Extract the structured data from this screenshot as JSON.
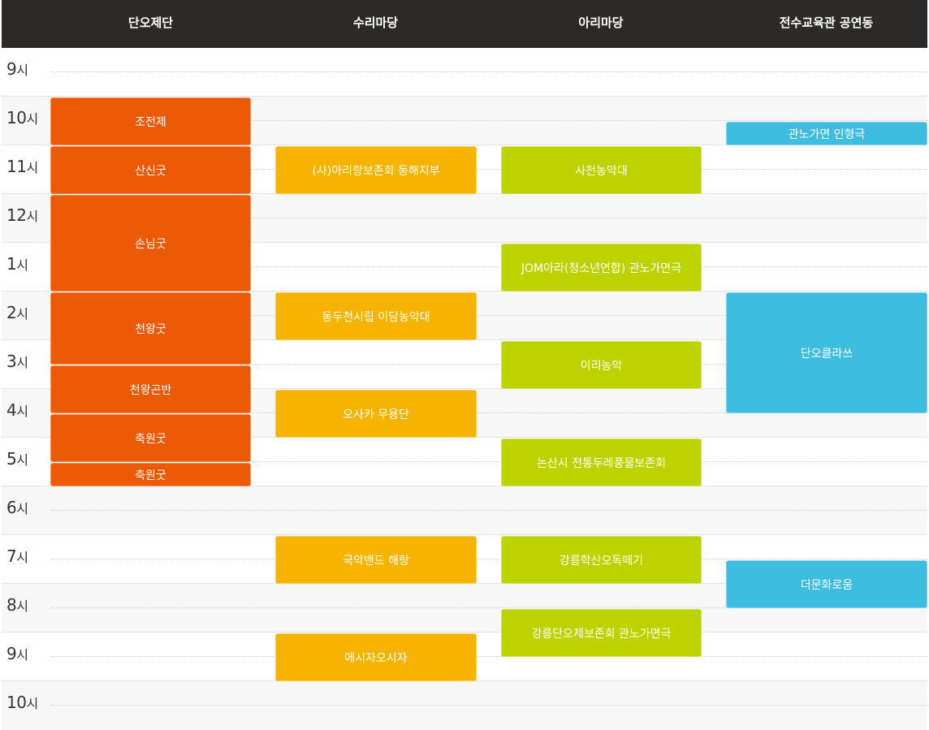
{
  "columns": [
    "단오제단",
    "수리마당",
    "아리마당",
    "전수교육관 공연동"
  ],
  "hours": [
    "9",
    "10",
    "11",
    "12",
    "1",
    "2",
    "3",
    "4",
    "5",
    "6",
    "7",
    "8",
    "9",
    "10"
  ],
  "hour_suffix": "시",
  "events": {
    "dano_1": "조전제",
    "dano_2": "산신굿",
    "dano_3": "손님굿",
    "dano_4": "천왕굿",
    "dano_5": "천왕곤반",
    "dano_6": "축원굿",
    "dano_7": "축원굿",
    "suri_1": "(사)아리랑보존회 동해지부",
    "suri_2": "동두천시립 이담농악대",
    "suri_3": "오사카 무용단",
    "suri_4": "국악밴드 해랑",
    "suri_5": "에시자오시자",
    "ari_1": "사천농악대",
    "ari_2": "JOM아라(청소년연합) 관노가면극",
    "ari_3": "이리농악",
    "ari_4": "논산시 전통두레풍물보존회",
    "ari_5": "강릉학산오독떼기",
    "ari_6": "강릉단오제보존회 관노가면극",
    "hall_1": "관노가면 인형극",
    "hall_2": "단오클라쓰",
    "hall_3": "더문화로움"
  },
  "colors": {
    "header": "#2b2a28",
    "dano": "#ec5a05",
    "suri": "#f6b400",
    "ari": "#bdd300",
    "hall": "#3ebde0"
  }
}
